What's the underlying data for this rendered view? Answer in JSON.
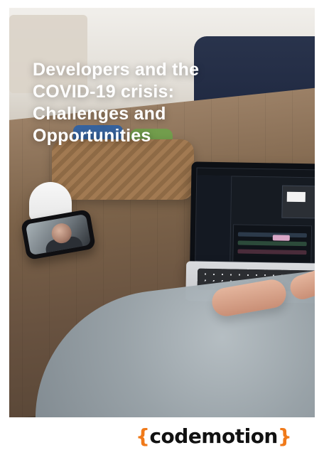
{
  "cover": {
    "title_lines": [
      "Developers and the",
      "COVID-19 crisis:",
      "Challenges and",
      "Opportunities"
    ]
  },
  "branding": {
    "left_brace": "{",
    "name": "codemotion",
    "right_brace": "}",
    "colors": {
      "accent": "#f07a1a",
      "text": "#111111"
    }
  }
}
